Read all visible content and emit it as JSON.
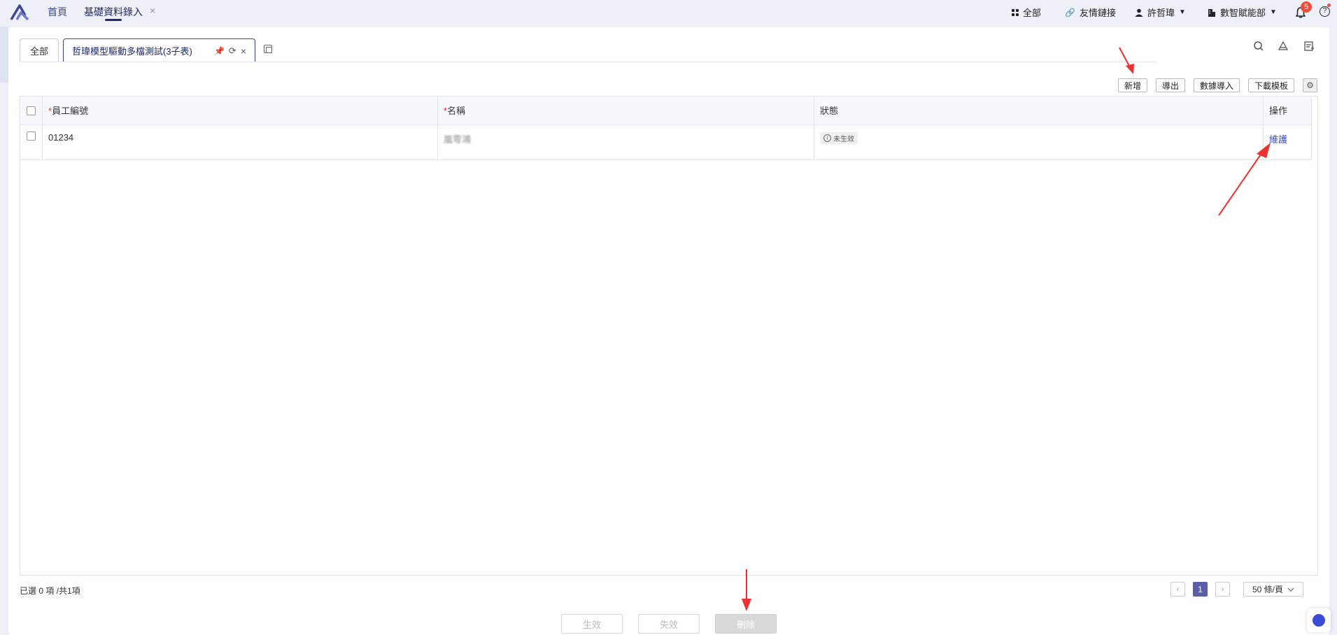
{
  "topnav": {
    "home": "首頁",
    "active_tab": "基礎資料錄入",
    "close": "×",
    "all": "全部",
    "friend_link": "友情鏈接",
    "user": "許哲瑋",
    "dept": "數智賦能部",
    "bell_count": "5",
    "help": "?"
  },
  "tabs": {
    "all": "全部",
    "model": "哲瑋模型驅動多檔測試(3子表)"
  },
  "toolbar": {
    "add": "新增",
    "export": "導出",
    "import": "數據導入",
    "download_template": "下載模板"
  },
  "table": {
    "headers": {
      "emp_no": "員工編號",
      "name": "名稱",
      "status": "狀態",
      "action": "操作"
    },
    "rows": [
      {
        "emp_no": "01234",
        "name": "嵐雩鴻",
        "status": "未生效",
        "action": "維護"
      }
    ]
  },
  "footer": {
    "selected": "已選 0 項 /共1項",
    "page": "1",
    "page_size": "50 條/頁",
    "btn_activate": "生效",
    "btn_deactivate": "失效",
    "btn_delete": "刪除"
  },
  "colors": {
    "accent": "#3b4699",
    "link": "#3b4bd6",
    "badge": "#f04d3a",
    "arrow": "#f03030"
  }
}
